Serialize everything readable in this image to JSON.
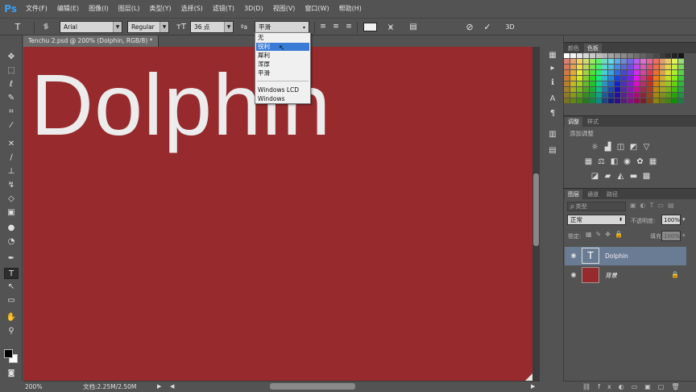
{
  "app": {
    "logo": "Ps"
  },
  "menu": [
    "文件(F)",
    "编辑(E)",
    "图像(I)",
    "图层(L)",
    "类型(Y)",
    "选择(S)",
    "滤镜(T)",
    "3D(D)",
    "视图(V)",
    "窗口(W)",
    "帮助(H)"
  ],
  "options": {
    "font_family": "Arial",
    "font_style": "Regular",
    "font_size": "36 点",
    "aa_label": "ªa",
    "aa_value": "平滑",
    "aa_options": [
      "无",
      "锐利",
      "犀利",
      "浑厚",
      "平滑",
      "Windows LCD",
      "Windows"
    ],
    "aa_selected_index": 1,
    "threed_label": "3D"
  },
  "document": {
    "tab_title": "Tenchu 2.psd @ 200% (Dolphin, RGB/8) *",
    "canvas_text": "Dolphin",
    "canvas_color": "#962a2c",
    "zoom": "200%",
    "doc_size": "文档:2.25M/2.50M"
  },
  "panels": {
    "swatches_tabs": [
      "颜色",
      "色板"
    ],
    "adjust_tabs": [
      "调整",
      "样式"
    ],
    "adjust_title": "添加调整",
    "layers_tabs": [
      "图层",
      "通道",
      "路径"
    ],
    "layers_kind": "ρ 类型",
    "blend_mode": "正常",
    "opacity_label": "不透明度:",
    "opacity_value": "100%",
    "lock_label": "锁定:",
    "fill_label": "填充:",
    "fill_value": "100%",
    "layers": [
      {
        "name": "Dolphin",
        "type": "text",
        "selected": true
      },
      {
        "name": "背景",
        "type": "background",
        "locked": true
      }
    ]
  },
  "colors": {
    "foreground": "#000000",
    "background": "#ffffff",
    "selection": "#3a7bd5"
  }
}
